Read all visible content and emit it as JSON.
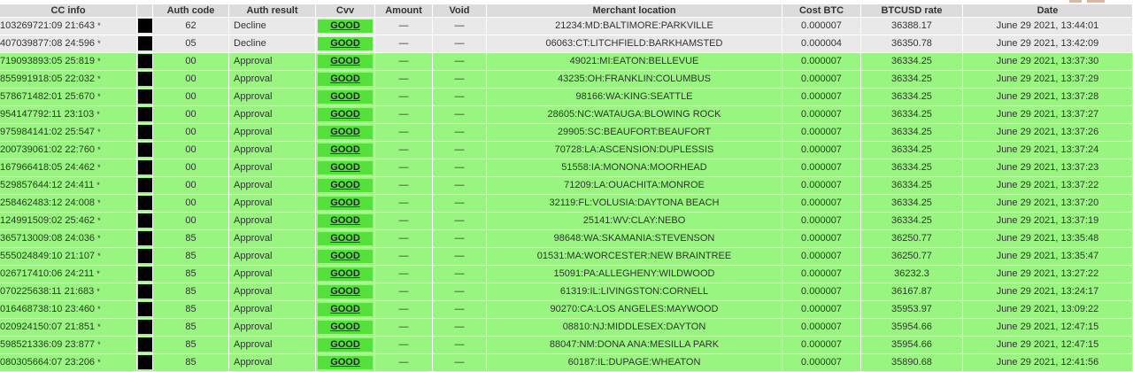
{
  "table": {
    "headers": [
      "CC info",
      "",
      "Auth code",
      "Auth result",
      "Cvv",
      "Amount",
      "Void",
      "Merchant location",
      "Cost BTC",
      "BTCUSD rate",
      "Date"
    ],
    "rows": [
      {
        "cc": "103269721:09 21:643",
        "star": "*",
        "auth_code": "62",
        "auth_result": "Decline",
        "cvv": "GOOD",
        "amount": "—",
        "void": "—",
        "location": "21234:MD:BALTIMORE:PARKVILLE",
        "cost_btc": "0.000007",
        "rate": "36388.17",
        "date": "June 29 2021, 13:44:01",
        "status": "decline"
      },
      {
        "cc": "407039877:08 24:596",
        "star": "*",
        "auth_code": "05",
        "auth_result": "Decline",
        "cvv": "GOOD",
        "amount": "—",
        "void": "—",
        "location": "06063:CT:LITCHFIELD:BARKHAMSTED",
        "cost_btc": "0.000004",
        "rate": "36350.78",
        "date": "June 29 2021, 13:42:09",
        "status": "decline"
      },
      {
        "cc": "719093893:05 25:819",
        "star": "*",
        "auth_code": "00",
        "auth_result": "Approval",
        "cvv": "GOOD",
        "amount": "—",
        "void": "—",
        "location": "49021:MI:EATON:BELLEVUE",
        "cost_btc": "0.000007",
        "rate": "36334.25",
        "date": "June 29 2021, 13:37:30",
        "status": "approval"
      },
      {
        "cc": "855991918:05 22:032",
        "star": "*",
        "auth_code": "00",
        "auth_result": "Approval",
        "cvv": "GOOD",
        "amount": "—",
        "void": "—",
        "location": "43235:OH:FRANKLIN:COLUMBUS",
        "cost_btc": "0.000007",
        "rate": "36334.25",
        "date": "June 29 2021, 13:37:29",
        "status": "approval"
      },
      {
        "cc": "578671482:01 25:670",
        "star": "*",
        "auth_code": "00",
        "auth_result": "Approval",
        "cvv": "GOOD",
        "amount": "—",
        "void": "—",
        "location": "98166:WA:KING:SEATTLE",
        "cost_btc": "0.000007",
        "rate": "36334.25",
        "date": "June 29 2021, 13:37:28",
        "status": "approval"
      },
      {
        "cc": "954147792:11 23:103",
        "star": "*",
        "auth_code": "00",
        "auth_result": "Approval",
        "cvv": "GOOD",
        "amount": "—",
        "void": "—",
        "location": "28605:NC:WATAUGA:BLOWING ROCK",
        "cost_btc": "0.000007",
        "rate": "36334.25",
        "date": "June 29 2021, 13:37:27",
        "status": "approval"
      },
      {
        "cc": "975984141:02 25:547",
        "star": "*",
        "auth_code": "00",
        "auth_result": "Approval",
        "cvv": "GOOD",
        "amount": "—",
        "void": "—",
        "location": "29905:SC:BEAUFORT:BEAUFORT",
        "cost_btc": "0.000007",
        "rate": "36334.25",
        "date": "June 29 2021, 13:37:26",
        "status": "approval"
      },
      {
        "cc": "200739061:02 22:760",
        "star": "*",
        "auth_code": "00",
        "auth_result": "Approval",
        "cvv": "GOOD",
        "amount": "—",
        "void": "—",
        "location": "70728:LA:ASCENSION:DUPLESSIS",
        "cost_btc": "0.000007",
        "rate": "36334.25",
        "date": "June 29 2021, 13:37:24",
        "status": "approval"
      },
      {
        "cc": "167966418:05 24:462",
        "star": "*",
        "auth_code": "00",
        "auth_result": "Approval",
        "cvv": "GOOD",
        "amount": "—",
        "void": "—",
        "location": "51558:IA:MONONA:MOORHEAD",
        "cost_btc": "0.000007",
        "rate": "36334.25",
        "date": "June 29 2021, 13:37:23",
        "status": "approval"
      },
      {
        "cc": "529857644:12 24:411",
        "star": "*",
        "auth_code": "00",
        "auth_result": "Approval",
        "cvv": "GOOD",
        "amount": "—",
        "void": "—",
        "location": "71209:LA:OUACHITA:MONROE",
        "cost_btc": "0.000007",
        "rate": "36334.25",
        "date": "June 29 2021, 13:37:22",
        "status": "approval"
      },
      {
        "cc": "258462483:12 24:008",
        "star": "*",
        "auth_code": "00",
        "auth_result": "Approval",
        "cvv": "GOOD",
        "amount": "—",
        "void": "—",
        "location": "32119:FL:VOLUSIA:DAYTONA BEACH",
        "cost_btc": "0.000007",
        "rate": "36334.25",
        "date": "June 29 2021, 13:37:20",
        "status": "approval"
      },
      {
        "cc": "124991509:02 25:462",
        "star": "*",
        "auth_code": "00",
        "auth_result": "Approval",
        "cvv": "GOOD",
        "amount": "—",
        "void": "—",
        "location": "25141:WV:CLAY:NEBO",
        "cost_btc": "0.000007",
        "rate": "36334.25",
        "date": "June 29 2021, 13:37:19",
        "status": "approval"
      },
      {
        "cc": "365713009:08 24:036",
        "star": "*",
        "auth_code": "85",
        "auth_result": "Approval",
        "cvv": "GOOD",
        "amount": "—",
        "void": "—",
        "location": "98648:WA:SKAMANIA:STEVENSON",
        "cost_btc": "0.000007",
        "rate": "36250.77",
        "date": "June 29 2021, 13:35:48",
        "status": "approval"
      },
      {
        "cc": "555024849:10 21:107",
        "star": "*",
        "auth_code": "85",
        "auth_result": "Approval",
        "cvv": "GOOD",
        "amount": "—",
        "void": "—",
        "location": "01531:MA:WORCESTER:NEW BRAINTREE",
        "cost_btc": "0.000007",
        "rate": "36250.77",
        "date": "June 29 2021, 13:35:47",
        "status": "approval"
      },
      {
        "cc": "026717410:06 24:211",
        "star": "*",
        "auth_code": "85",
        "auth_result": "Approval",
        "cvv": "GOOD",
        "amount": "—",
        "void": "—",
        "location": "15091:PA:ALLEGHENY:WILDWOOD",
        "cost_btc": "0.000007",
        "rate": "36232.3",
        "date": "June 29 2021, 13:27:22",
        "status": "approval"
      },
      {
        "cc": "070225638:11 21:683",
        "star": "*",
        "auth_code": "85",
        "auth_result": "Approval",
        "cvv": "GOOD",
        "amount": "—",
        "void": "—",
        "location": "61319:IL:LIVINGSTON:CORNELL",
        "cost_btc": "0.000007",
        "rate": "36167.87",
        "date": "June 29 2021, 13:24:17",
        "status": "approval"
      },
      {
        "cc": "016468738:10 23:460",
        "star": "*",
        "auth_code": "85",
        "auth_result": "Approval",
        "cvv": "GOOD",
        "amount": "—",
        "void": "—",
        "location": "90270:CA:LOS ANGELES:MAYWOOD",
        "cost_btc": "0.000007",
        "rate": "35953.97",
        "date": "June 29 2021, 13:09:22",
        "status": "approval"
      },
      {
        "cc": "020924150:07 21:851",
        "star": "*",
        "auth_code": "85",
        "auth_result": "Approval",
        "cvv": "GOOD",
        "amount": "—",
        "void": "—",
        "location": "08810:NJ:MIDDLESEX:DAYTON",
        "cost_btc": "0.000007",
        "rate": "35954.66",
        "date": "June 29 2021, 12:47:15",
        "status": "approval"
      },
      {
        "cc": "598521336:09 23:877",
        "star": "*",
        "auth_code": "85",
        "auth_result": "Approval",
        "cvv": "GOOD",
        "amount": "—",
        "void": "—",
        "location": "88047:NM:DONA ANA:MESILLA PARK",
        "cost_btc": "0.000007",
        "rate": "35954.66",
        "date": "June 29 2021, 12:47:15",
        "status": "approval"
      },
      {
        "cc": "080305664:07 23:206",
        "star": "*",
        "auth_code": "85",
        "auth_result": "Approval",
        "cvv": "GOOD",
        "amount": "—",
        "void": "—",
        "location": "60187:IL:DUPAGE:WHEATON",
        "cost_btc": "0.000007",
        "rate": "35890.68",
        "date": "June 29 2021, 12:41:56",
        "status": "approval"
      }
    ]
  },
  "colors": {
    "header_bg": "#dcdcdc",
    "decline_row": "#e9e9e9",
    "approval_row": "#98f57f",
    "cvv_badge": "#55e03b"
  }
}
